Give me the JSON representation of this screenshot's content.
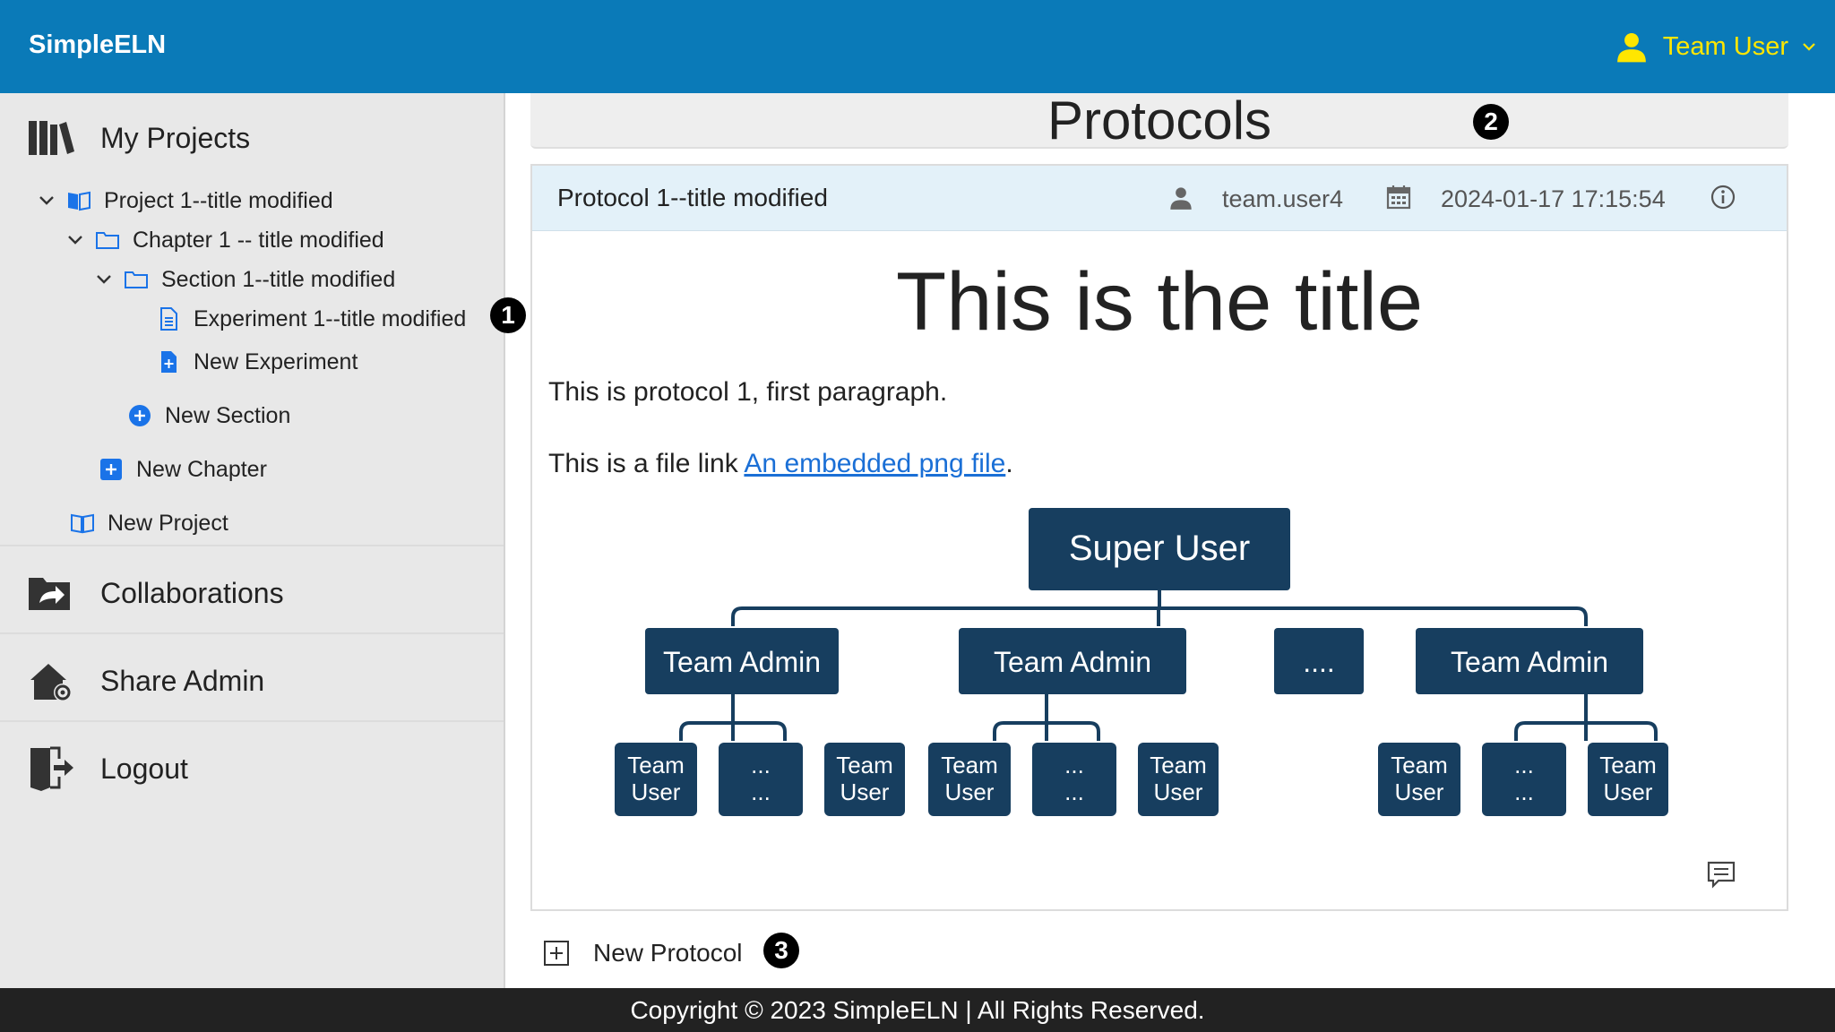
{
  "header": {
    "brand": "SimpleELN",
    "user_name": "Team User"
  },
  "sidebar": {
    "my_projects": "My Projects",
    "tree": {
      "project": "Project 1--title modified",
      "chapter": "Chapter 1 -- title modified",
      "section": "Section 1--title modified",
      "experiment": "Experiment 1--title modified",
      "new_experiment": "New Experiment",
      "new_section": "New Section",
      "new_chapter": "New Chapter",
      "new_project": "New Project"
    },
    "collaborations": "Collaborations",
    "share_admin": "Share Admin",
    "logout": "Logout"
  },
  "badges": {
    "b1": "1",
    "b2": "2",
    "b3": "3"
  },
  "main": {
    "page_title": "Protocols",
    "protocol": {
      "title": "Protocol 1--title modified",
      "user": "team.user4",
      "date": "2024-01-17 17:15:54",
      "doc_title": "This is the title",
      "paragraph1": "This is protocol 1, first paragraph.",
      "paragraph2_prefix": "This is a file link ",
      "link_text": "An embedded png file",
      "paragraph2_suffix": "."
    },
    "new_protocol": "New Protocol"
  },
  "org_chart": {
    "root": "Super User",
    "admins": [
      "Team Admin",
      "Team Admin",
      "....",
      "Team Admin"
    ],
    "user_top": [
      "Team",
      "...",
      "Team",
      "Team",
      "...",
      "Team",
      "Team",
      "...",
      "Team"
    ],
    "user_bottom": [
      "User",
      "...",
      "User",
      "User",
      "...",
      "User",
      "User",
      "...",
      "User"
    ]
  },
  "footer": {
    "copyright": "Copyright © 2023 SimpleELN | All Rights Reserved."
  },
  "colors": {
    "header_bg": "#0a7ab8",
    "user_accent": "#ffe600",
    "chart_box": "#173e5f",
    "tree_icon": "#1a73e8",
    "footer_bg": "#222222"
  }
}
